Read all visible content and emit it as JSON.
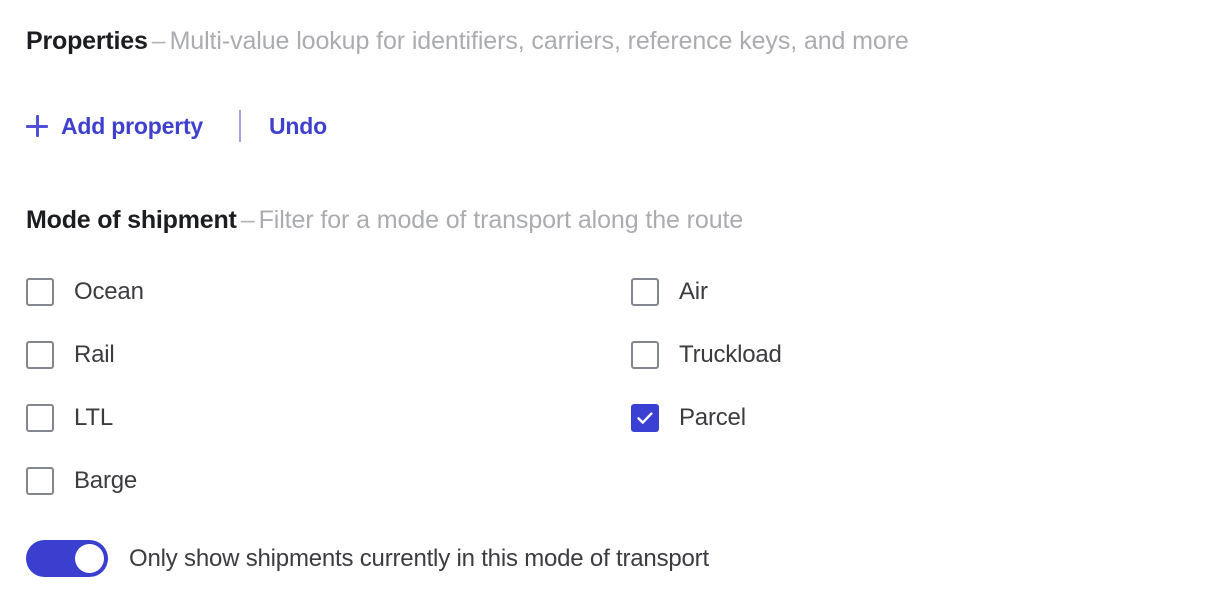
{
  "properties_section": {
    "title": "Properties",
    "dash": "–",
    "description": "Multi-value lookup for identifiers, carriers, reference keys, and more",
    "add_property_label": "Add property",
    "add_icon": "plus-icon",
    "undo_label": "Undo"
  },
  "mode_section": {
    "title": "Mode of shipment",
    "dash": "–",
    "description": "Filter for a mode of transport along the route",
    "columns": [
      {
        "options": [
          {
            "label": "Ocean",
            "checked": false
          },
          {
            "label": "Rail",
            "checked": false
          },
          {
            "label": "LTL",
            "checked": false
          },
          {
            "label": "Barge",
            "checked": false
          }
        ]
      },
      {
        "options": [
          {
            "label": "Air",
            "checked": false
          },
          {
            "label": "Truckload",
            "checked": false
          },
          {
            "label": "Parcel",
            "checked": true
          }
        ]
      }
    ],
    "toggle": {
      "label": "Only show shipments currently in this mode of transport",
      "on": true
    }
  },
  "colors": {
    "accent": "#3b40d4",
    "accent_link": "#4040cf",
    "toggle_on": "#3a3fd0",
    "checkbox_border": "#83868c",
    "heading_text": "#1c1d20",
    "muted_text": "#aaacb0",
    "label_text": "#3b3c3f",
    "divider": "#9fa4e6",
    "background": "#ffffff"
  }
}
